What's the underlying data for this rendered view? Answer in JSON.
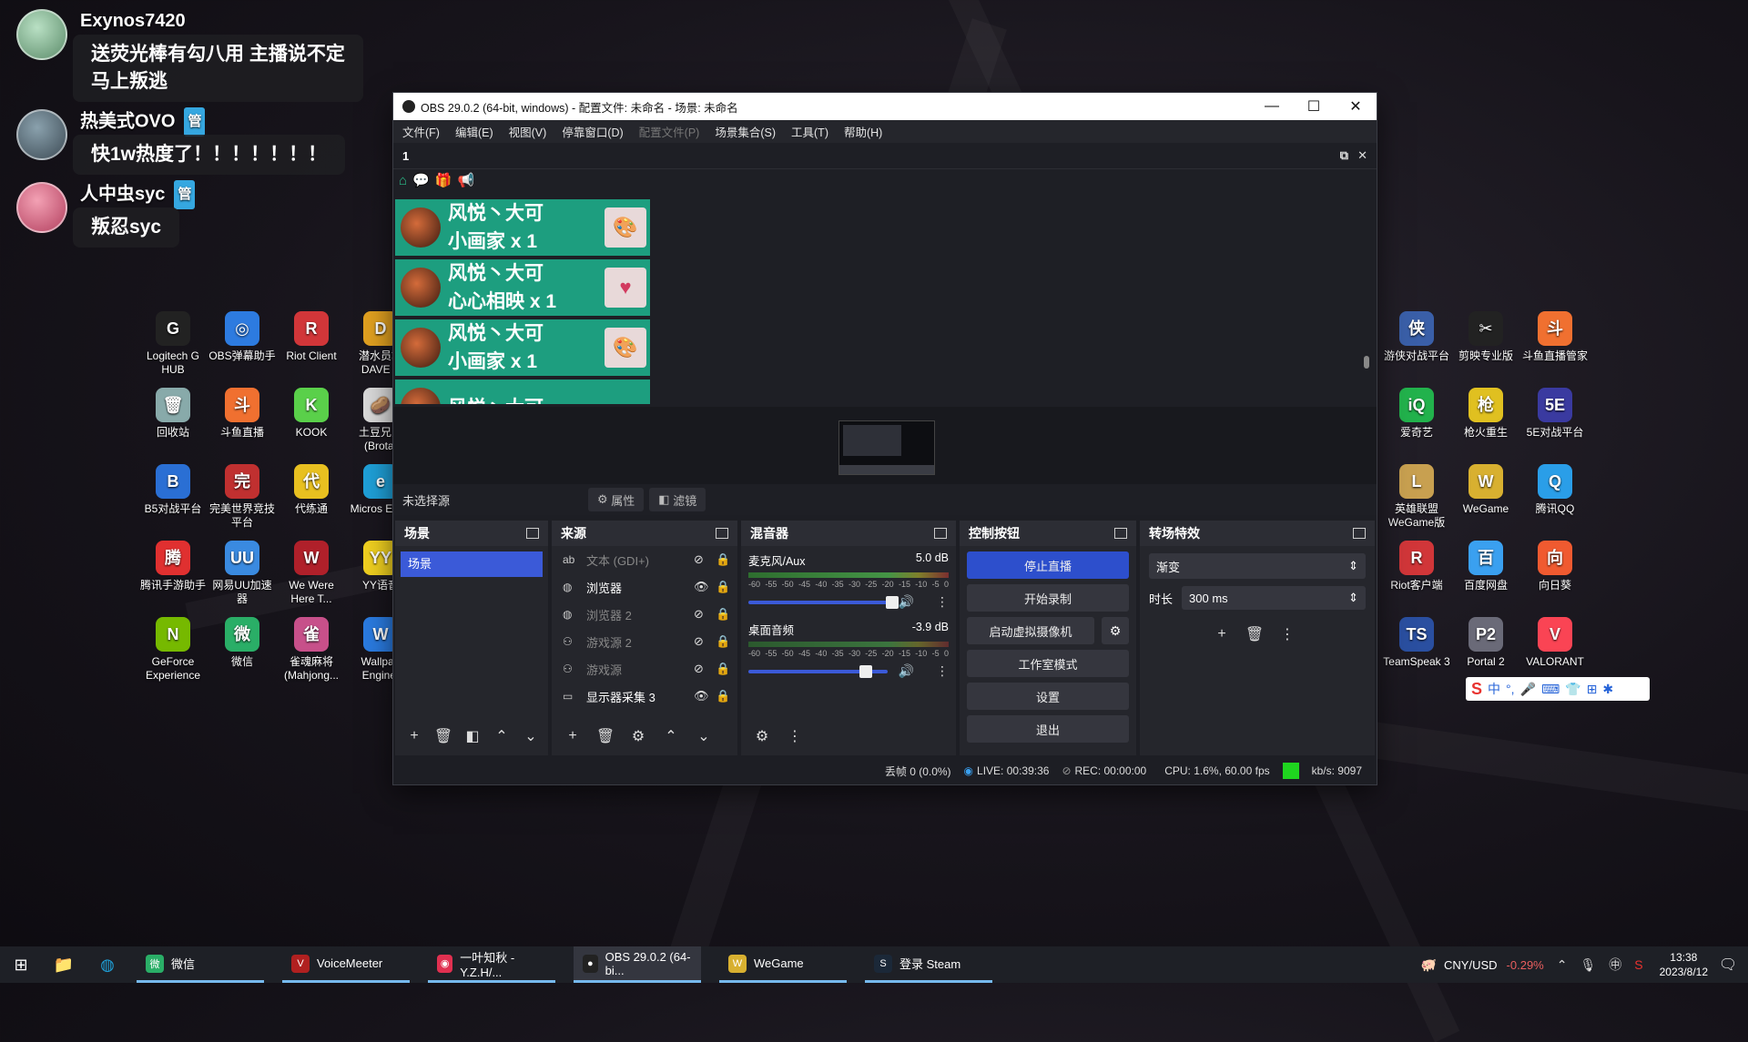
{
  "chat": [
    {
      "name": "Exynos7420",
      "badge": "",
      "lines": [
        "送荧光棒有勾八用 主播说不定",
        "马上叛逃"
      ]
    },
    {
      "name": "热美式OVO",
      "badge": "管",
      "lines": [
        "快1w热度了！！！！！！！"
      ]
    },
    {
      "name": "人中虫syc",
      "badge": "管",
      "lines": [
        "叛忍syc"
      ]
    }
  ],
  "desktop_left": [
    {
      "label": "Logitech G HUB",
      "color": "#222",
      "glyph": "G"
    },
    {
      "label": "OBS弹幕助手",
      "color": "#2d7be0",
      "glyph": "◎"
    },
    {
      "label": "Riot Client",
      "color": "#d13639",
      "glyph": "R"
    },
    {
      "label": "潜水员戴 DAVE T",
      "color": "#e0a020",
      "glyph": "D"
    },
    {
      "label": "回收站",
      "color": "#8aa",
      "glyph": "🗑"
    },
    {
      "label": "斗鱼直播",
      "color": "#f07030",
      "glyph": "斗"
    },
    {
      "label": "KOOK",
      "color": "#5ad04a",
      "glyph": "K"
    },
    {
      "label": "土豆兄弟 (Brotat",
      "color": "#d9d9d9",
      "glyph": "🥔"
    },
    {
      "label": "B5对战平台",
      "color": "#2a6fd4",
      "glyph": "B"
    },
    {
      "label": "完美世界竞技平台",
      "color": "#c03030",
      "glyph": "完"
    },
    {
      "label": "代练通",
      "color": "#e8c020",
      "glyph": "代"
    },
    {
      "label": "Micros Edge",
      "color": "#1fa0d8",
      "glyph": "e"
    },
    {
      "label": "腾讯手游助手",
      "color": "#e03030",
      "glyph": "腾"
    },
    {
      "label": "网易UU加速器",
      "color": "#3a8ae0",
      "glyph": "UU"
    },
    {
      "label": "We Were Here T...",
      "color": "#b0202a",
      "glyph": "W"
    },
    {
      "label": "YY语音",
      "color": "#f0d020",
      "glyph": "YY"
    },
    {
      "label": "GeForce Experience",
      "color": "#76b900",
      "glyph": "N"
    },
    {
      "label": "微信",
      "color": "#2aae67",
      "glyph": "微"
    },
    {
      "label": "雀魂麻将 (Mahjong...",
      "color": "#c7508a",
      "glyph": "雀"
    },
    {
      "label": "Wallpap Engine:",
      "color": "#2a7be0",
      "glyph": "W"
    }
  ],
  "desktop_right": [
    {
      "label": "游侠对战平台",
      "color": "#3a5fa8",
      "glyph": "侠"
    },
    {
      "label": "剪映专业版",
      "color": "#222",
      "glyph": "✂"
    },
    {
      "label": "斗鱼直播管家",
      "color": "#f07030",
      "glyph": "斗"
    },
    {
      "label": "爱奇艺",
      "color": "#22b24c",
      "glyph": "iQ"
    },
    {
      "label": "枪火重生",
      "color": "#e0c020",
      "glyph": "枪"
    },
    {
      "label": "5E对战平台",
      "color": "#3a3aa0",
      "glyph": "5E"
    },
    {
      "label": "英雄联盟 WeGame版",
      "color": "#c8a050",
      "glyph": "L"
    },
    {
      "label": "WeGame",
      "color": "#d8b030",
      "glyph": "W"
    },
    {
      "label": "腾讯QQ",
      "color": "#2a9ee8",
      "glyph": "Q"
    },
    {
      "label": "Riot客户端",
      "color": "#d13639",
      "glyph": "R"
    },
    {
      "label": "百度网盘",
      "color": "#3aa0f0",
      "glyph": "百"
    },
    {
      "label": "向日葵",
      "color": "#f05a30",
      "glyph": "向"
    },
    {
      "label": "TeamSpeak 3",
      "color": "#2a4fa0",
      "glyph": "TS"
    },
    {
      "label": "Portal 2",
      "color": "#6a6a78",
      "glyph": "P2"
    },
    {
      "label": "VALORANT",
      "color": "#fa4454",
      "glyph": "V"
    }
  ],
  "obs": {
    "title": "OBS 29.0.2 (64-bit, windows) - 配置文件: 未命名 - 场景: 未命名",
    "menu": [
      "文件(F)",
      "编辑(E)",
      "视图(V)",
      "停靠窗口(D)",
      "配置文件(P)",
      "场景集合(S)",
      "工具(T)",
      "帮助(H)"
    ],
    "dock1_title": "1",
    "gifts": [
      {
        "user": "风悦丶大可",
        "gift": "小画家 x 1"
      },
      {
        "user": "风悦丶大可",
        "gift": "心心相映 x 1"
      },
      {
        "user": "风悦丶大可",
        "gift": "小画家 x 1"
      },
      {
        "user": "风悦丶大可",
        "gift": ""
      }
    ],
    "no_source": "未选择源",
    "properties_label": "属性",
    "filters_label": "滤镜",
    "scenes_title": "场景",
    "scene_items": [
      "场景"
    ],
    "sources_title": "来源",
    "sources": [
      {
        "icon": "ab",
        "name": "文本 (GDI+)",
        "visible": false
      },
      {
        "icon": "◍",
        "name": "浏览器",
        "visible": true
      },
      {
        "icon": "◍",
        "name": "浏览器 2",
        "visible": false
      },
      {
        "icon": "⚇",
        "name": "游戏源 2",
        "visible": false
      },
      {
        "icon": "⚇",
        "name": "游戏源",
        "visible": false
      },
      {
        "icon": "▭",
        "name": "显示器采集 3",
        "visible": true
      }
    ],
    "mixer_title": "混音器",
    "mixer": [
      {
        "name": "麦克风/Aux",
        "db": "5.0 dB",
        "volume": 0.83
      },
      {
        "name": "桌面音频",
        "db": "-3.9 dB",
        "volume": 0.68
      }
    ],
    "meter_ticks": [
      "-60",
      "-55",
      "-50",
      "-45",
      "-40",
      "-35",
      "-30",
      "-25",
      "-20",
      "-15",
      "-10",
      "-5",
      "0"
    ],
    "controls_title": "控制按钮",
    "controls": {
      "stop_stream": "停止直播",
      "start_record": "开始录制",
      "virtual_cam": "启动虚拟摄像机",
      "studio_mode": "工作室模式",
      "settings": "设置",
      "exit": "退出"
    },
    "transitions_title": "转场特效",
    "transition_type": "渐变",
    "duration_label": "时长",
    "duration_value": "300 ms",
    "status": {
      "dropped": "丢帧 0 (0.0%)",
      "live": "LIVE: 00:39:36",
      "rec": "REC: 00:00:00",
      "cpu": "CPU: 1.6%, 60.00 fps",
      "kbps": "kb/s: 9097"
    }
  },
  "ime_glyphs": [
    "中",
    "°,",
    "🎤",
    "⌨",
    "👕",
    "⊞",
    "✱"
  ],
  "taskbar": {
    "apps": [
      {
        "label": "微信",
        "color": "#2aae67",
        "glyph": "微"
      },
      {
        "label": "VoiceMeeter",
        "color": "#b02020",
        "glyph": "V"
      },
      {
        "label": "一叶知秋 - Y.Z.H/...",
        "color": "#e03050",
        "glyph": "◉"
      },
      {
        "label": "OBS 29.0.2 (64-bi...",
        "color": "#222",
        "glyph": "●"
      },
      {
        "label": "WeGame",
        "color": "#d8b030",
        "glyph": "W"
      },
      {
        "label": "登录 Steam",
        "color": "#1b2838",
        "glyph": "S"
      }
    ],
    "currency": "CNY/USD",
    "change": "-0.29%",
    "time": "13:38",
    "date": "2023/8/12"
  }
}
